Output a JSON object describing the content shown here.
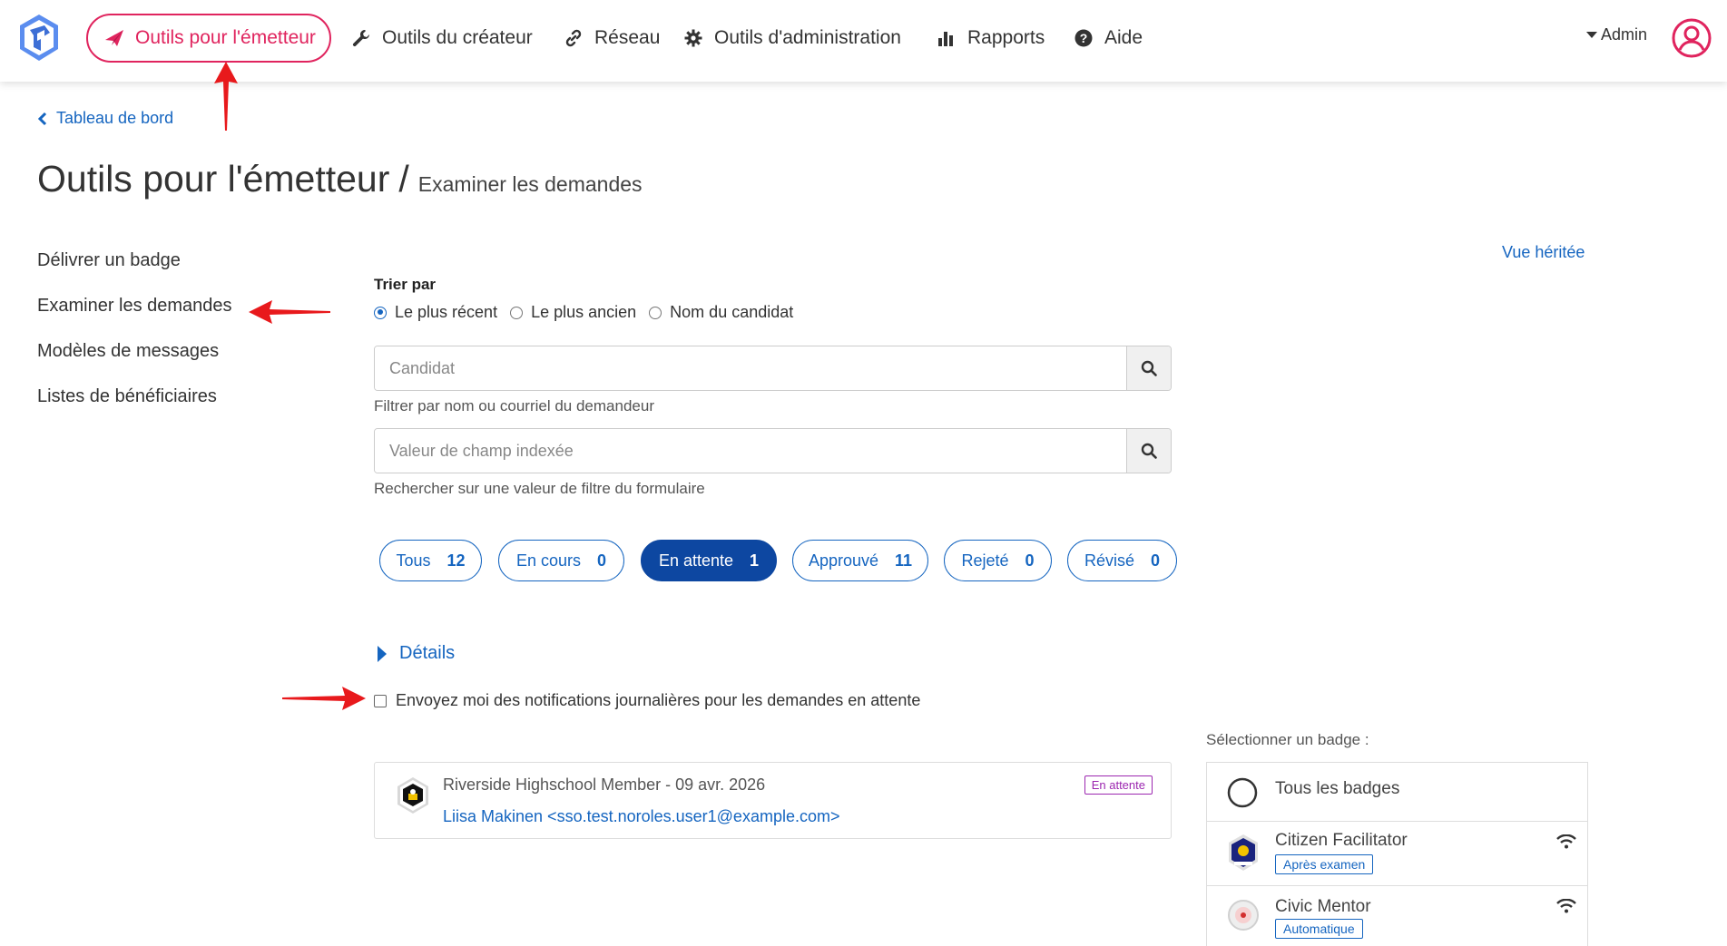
{
  "nav": {
    "items": [
      {
        "label": "Outils pour l'émetteur",
        "icon": "paper-plane-icon"
      },
      {
        "label": "Outils du créateur",
        "icon": "wrench-icon"
      },
      {
        "label": "Réseau",
        "icon": "link-icon"
      },
      {
        "label": "Outils d'administration",
        "icon": "gear-icon"
      },
      {
        "label": "Rapports",
        "icon": "bar-chart-icon"
      },
      {
        "label": "Aide",
        "icon": "question-circle-icon"
      }
    ],
    "user_label": "Admin",
    "accent": "#e0245e"
  },
  "breadcrumb": {
    "back_label": "Tableau de bord"
  },
  "page": {
    "title": "Outils pour l'émetteur",
    "separator": "/",
    "subtitle": "Examiner les demandes"
  },
  "sidebar": {
    "items": [
      {
        "label": "Délivrer un badge"
      },
      {
        "label": "Examiner les demandes"
      },
      {
        "label": "Modèles de messages"
      },
      {
        "label": "Listes de bénéficiaires"
      }
    ]
  },
  "legacy_view_label": "Vue héritée",
  "sort": {
    "label": "Trier par",
    "options": [
      "Le plus récent",
      "Le plus ancien",
      "Nom du candidat"
    ],
    "selected": "Le plus récent"
  },
  "search": {
    "candidate_placeholder": "Candidat",
    "candidate_help": "Filtrer par nom ou courriel du demandeur",
    "field_placeholder": "Valeur de champ indexée",
    "field_help": "Rechercher sur une valeur de filtre du formulaire"
  },
  "status_filters": [
    {
      "label": "Tous",
      "count": "12"
    },
    {
      "label": "En cours",
      "count": "0"
    },
    {
      "label": "En attente",
      "count": "1",
      "active": true
    },
    {
      "label": "Approuvé",
      "count": "11"
    },
    {
      "label": "Rejeté",
      "count": "0"
    },
    {
      "label": "Révisé",
      "count": "0"
    }
  ],
  "details_label": "Détails",
  "notify_label": "Envoyez moi des notifications journalières pour les demandes en attente",
  "requests": [
    {
      "title": "Riverside Highschool Member - 09 avr. 2026",
      "applicant": "Liisa Makinen <sso.test.noroles.user1@example.com>",
      "status": "En attente"
    }
  ],
  "badge_selector": {
    "label": "Sélectionner un badge :",
    "all_label": "Tous les badges",
    "badges": [
      {
        "name": "Citizen Facilitator",
        "tag": "Après examen"
      },
      {
        "name": "Civic Mentor",
        "tag": "Automatique"
      }
    ]
  },
  "colors": {
    "link": "#1565c0",
    "active_pill": "#0d47a1",
    "pending": "#9c27b0",
    "annotation_arrow": "#e8191c"
  }
}
